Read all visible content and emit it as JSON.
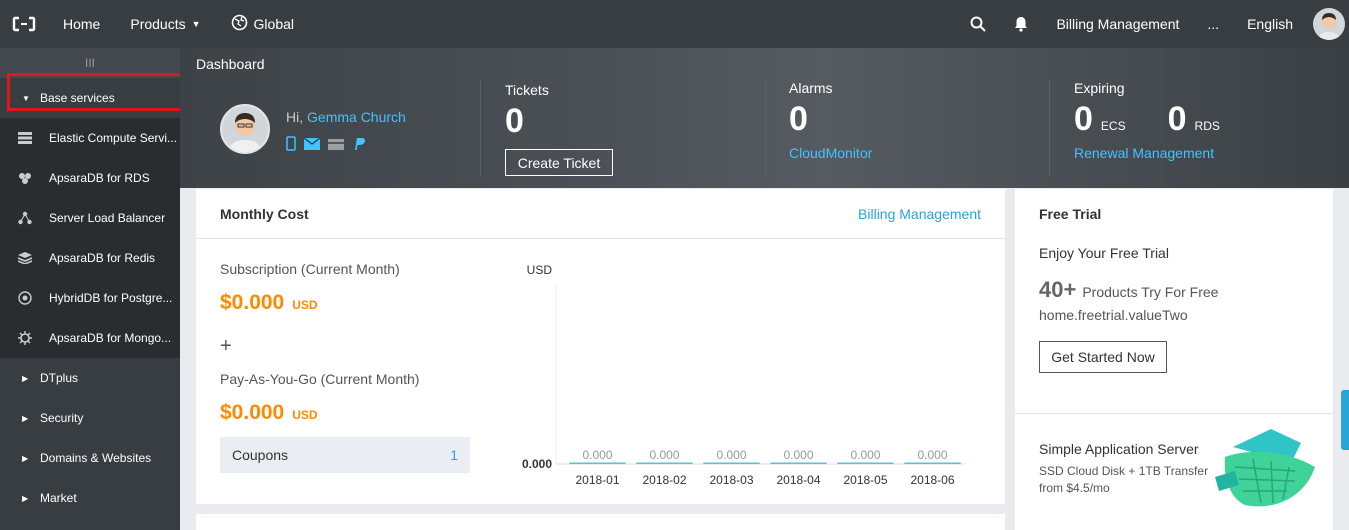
{
  "topbar": {
    "nav": [
      {
        "label": "Home"
      },
      {
        "label": "Products"
      },
      {
        "label": "Global"
      }
    ],
    "right": {
      "billing": "Billing Management",
      "more": "...",
      "language": "English"
    }
  },
  "sidebar": {
    "collapse_glyph": "III",
    "base_services_label": "Base services",
    "items": [
      {
        "label": "Elastic Compute Servi...",
        "icon": "server-icon"
      },
      {
        "label": "ApsaraDB for RDS",
        "icon": "database-icon"
      },
      {
        "label": "Server Load Balancer",
        "icon": "network-icon"
      },
      {
        "label": "ApsaraDB for Redis",
        "icon": "layers-icon"
      },
      {
        "label": "HybridDB for Postgre...",
        "icon": "eye-icon"
      },
      {
        "label": "ApsaraDB for Mongo...",
        "icon": "gear-icon"
      }
    ],
    "groups": [
      {
        "label": "DTplus"
      },
      {
        "label": "Security"
      },
      {
        "label": "Domains & Websites"
      },
      {
        "label": "Market"
      }
    ]
  },
  "banner": {
    "title": "Dashboard",
    "greeting": "Hi,",
    "user_name": "Gemma Church",
    "tickets": {
      "label": "Tickets",
      "count": "0",
      "button": "Create Ticket"
    },
    "alarms": {
      "label": "Alarms",
      "count": "0",
      "link": "CloudMonitor"
    },
    "expiring": {
      "label": "Expiring",
      "ecs_count": "0",
      "ecs_label": "ECS",
      "rds_count": "0",
      "rds_label": "RDS",
      "link": "Renewal Management"
    }
  },
  "monthly_cost": {
    "title": "Monthly Cost",
    "link": "Billing Management",
    "subscription_label": "Subscription (Current Month)",
    "subscription_value": "$0.000",
    "subscription_unit": "USD",
    "plus": "+",
    "payg_label": "Pay-As-You-Go (Current Month)",
    "payg_value": "$0.000",
    "payg_unit": "USD",
    "coupons_label": "Coupons",
    "coupons_count": "1"
  },
  "chart_data": {
    "type": "bar",
    "categories": [
      "2018-01",
      "2018-02",
      "2018-03",
      "2018-04",
      "2018-05",
      "2018-06"
    ],
    "values": [
      0,
      0,
      0,
      0,
      0,
      0
    ],
    "data_labels": [
      "0.000",
      "0.000",
      "0.000",
      "0.000",
      "0.000",
      "0.000"
    ],
    "ylabel": "USD",
    "y_tick_label": "0.000",
    "grid": false,
    "color": "#5bc0de"
  },
  "free_trial": {
    "title": "Free Trial",
    "subtitle": "Enjoy Your Free Trial",
    "count": "40+",
    "count_text": "Products Try For Free",
    "value_key": "home.freetrial.valueTwo",
    "button": "Get Started Now",
    "promo_title": "Simple Application Server",
    "promo_line1": "SSD Cloud Disk + 1TB Transfer",
    "promo_line2": "from $4.5/mo"
  },
  "colors": {
    "accent": "#29a4d6",
    "cost": "#ff8a00",
    "highlight": "#e0161f",
    "topbar": "#373d41"
  }
}
